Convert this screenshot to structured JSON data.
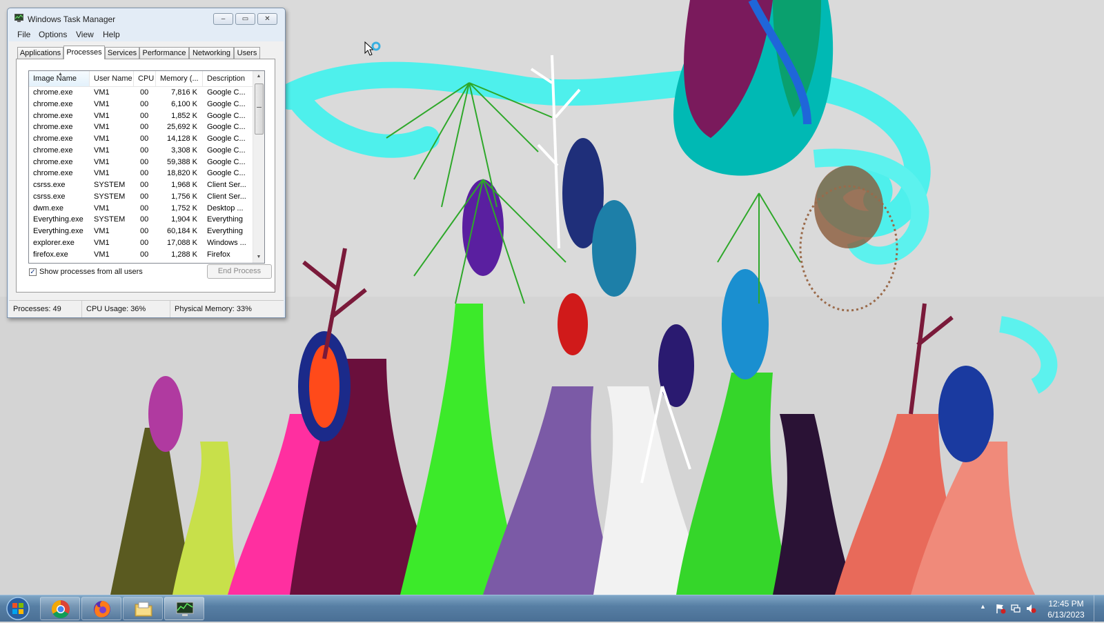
{
  "window": {
    "title": "Windows Task Manager",
    "buttons": {
      "minimize": "–",
      "maximize": "▭",
      "close": "✕"
    }
  },
  "menu": [
    "File",
    "Options",
    "View",
    "Help"
  ],
  "tabs": [
    {
      "label": "Applications",
      "active": false
    },
    {
      "label": "Processes",
      "active": true
    },
    {
      "label": "Services",
      "active": false
    },
    {
      "label": "Performance",
      "active": false
    },
    {
      "label": "Networking",
      "active": false
    },
    {
      "label": "Users",
      "active": false
    }
  ],
  "columns": {
    "image_name": "Image Name",
    "user_name": "User Name",
    "cpu": "CPU",
    "memory": "Memory (...",
    "description": "Description"
  },
  "processes": [
    {
      "name": "chrome.exe",
      "user": "VM1",
      "cpu": "00",
      "memory": "7,816 K",
      "desc": "Google C..."
    },
    {
      "name": "chrome.exe",
      "user": "VM1",
      "cpu": "00",
      "memory": "6,100 K",
      "desc": "Google C..."
    },
    {
      "name": "chrome.exe",
      "user": "VM1",
      "cpu": "00",
      "memory": "1,852 K",
      "desc": "Google C..."
    },
    {
      "name": "chrome.exe",
      "user": "VM1",
      "cpu": "00",
      "memory": "25,692 K",
      "desc": "Google C..."
    },
    {
      "name": "chrome.exe",
      "user": "VM1",
      "cpu": "00",
      "memory": "14,128 K",
      "desc": "Google C..."
    },
    {
      "name": "chrome.exe",
      "user": "VM1",
      "cpu": "00",
      "memory": "3,308 K",
      "desc": "Google C..."
    },
    {
      "name": "chrome.exe",
      "user": "VM1",
      "cpu": "00",
      "memory": "59,388 K",
      "desc": "Google C..."
    },
    {
      "name": "chrome.exe",
      "user": "VM1",
      "cpu": "00",
      "memory": "18,820 K",
      "desc": "Google C..."
    },
    {
      "name": "csrss.exe",
      "user": "SYSTEM",
      "cpu": "00",
      "memory": "1,968 K",
      "desc": "Client Ser..."
    },
    {
      "name": "csrss.exe",
      "user": "SYSTEM",
      "cpu": "00",
      "memory": "1,756 K",
      "desc": "Client Ser..."
    },
    {
      "name": "dwm.exe",
      "user": "VM1",
      "cpu": "00",
      "memory": "1,752 K",
      "desc": "Desktop ..."
    },
    {
      "name": "Everything.exe",
      "user": "SYSTEM",
      "cpu": "00",
      "memory": "1,904 K",
      "desc": "Everything"
    },
    {
      "name": "Everything.exe",
      "user": "VM1",
      "cpu": "00",
      "memory": "60,184 K",
      "desc": "Everything"
    },
    {
      "name": "explorer.exe",
      "user": "VM1",
      "cpu": "00",
      "memory": "17,088 K",
      "desc": "Windows ..."
    },
    {
      "name": "firefox.exe",
      "user": "VM1",
      "cpu": "00",
      "memory": "1,288 K",
      "desc": "Firefox"
    }
  ],
  "show_all_users": {
    "label": "Show processes from all users",
    "checked": true
  },
  "end_process_label": "End Process",
  "status": {
    "processes": "Processes: 49",
    "cpu": "CPU Usage: 36%",
    "memory": "Physical Memory: 33%"
  },
  "taskbar": {
    "pinned": [
      {
        "name": "chrome",
        "icon": "chrome-icon"
      },
      {
        "name": "firefox",
        "icon": "firefox-icon"
      },
      {
        "name": "explorer",
        "icon": "folder-icon"
      },
      {
        "name": "task-manager",
        "icon": "task-manager-icon"
      }
    ],
    "clock_time": "12:45 PM",
    "clock_date": "6/13/2023"
  },
  "colors": {
    "taskbar": "#577fa4",
    "window_frame": "#e3ecf6",
    "wallpaper_sky": "#d6d6d6"
  }
}
